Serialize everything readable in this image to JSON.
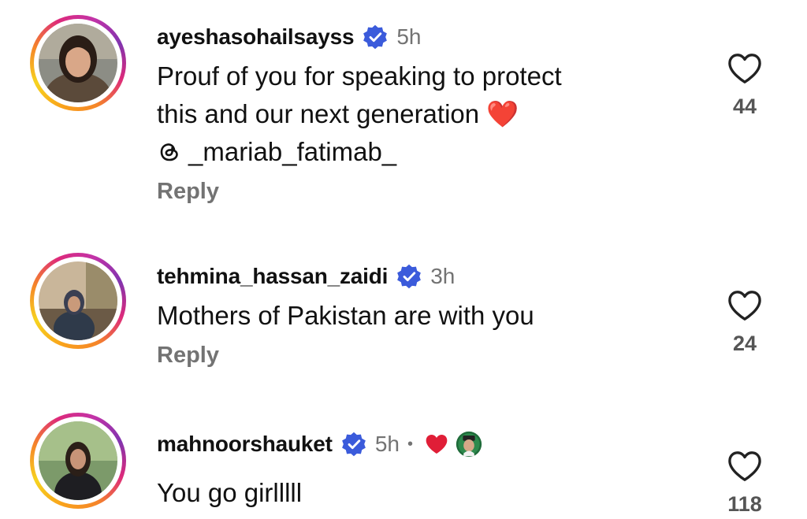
{
  "comments": [
    {
      "username": "ayeshasohailsayss",
      "time": "5h",
      "text_lines": [
        "Prouf of you for speaking to protect",
        "this and our next generation"
      ],
      "emoji": "❤️",
      "mention": "_mariab_fatimab_",
      "reply_label": "Reply",
      "likes": "44"
    },
    {
      "username": "tehmina_hassan_zaidi",
      "time": "3h",
      "text_lines": [
        "Mothers of Pakistan are with you"
      ],
      "reply_label": "Reply",
      "likes": "24"
    },
    {
      "username": "mahnoorshauket",
      "time": "5h",
      "separator": "•",
      "text_lines": [
        "You go girlllll"
      ],
      "likes": "118"
    }
  ],
  "colors": {
    "verified": "#3b5bdb",
    "muted": "#737373",
    "heart_red": "#e01e37"
  },
  "icons": [
    "verified-badge-icon",
    "heart-outline-icon",
    "threads-icon",
    "heart-reaction-icon"
  ]
}
